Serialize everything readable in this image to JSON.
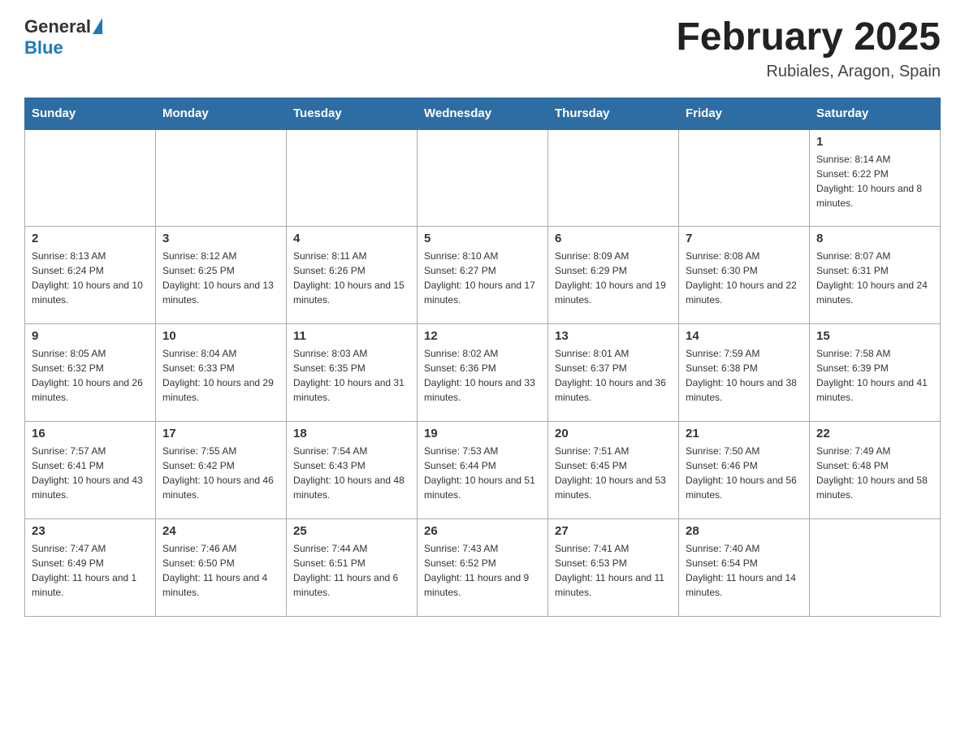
{
  "header": {
    "logo_general": "General",
    "logo_blue": "Blue",
    "month_title": "February 2025",
    "location": "Rubiales, Aragon, Spain"
  },
  "days_of_week": [
    "Sunday",
    "Monday",
    "Tuesday",
    "Wednesday",
    "Thursday",
    "Friday",
    "Saturday"
  ],
  "weeks": [
    [
      {
        "day": "",
        "info": ""
      },
      {
        "day": "",
        "info": ""
      },
      {
        "day": "",
        "info": ""
      },
      {
        "day": "",
        "info": ""
      },
      {
        "day": "",
        "info": ""
      },
      {
        "day": "",
        "info": ""
      },
      {
        "day": "1",
        "info": "Sunrise: 8:14 AM\nSunset: 6:22 PM\nDaylight: 10 hours and 8 minutes."
      }
    ],
    [
      {
        "day": "2",
        "info": "Sunrise: 8:13 AM\nSunset: 6:24 PM\nDaylight: 10 hours and 10 minutes."
      },
      {
        "day": "3",
        "info": "Sunrise: 8:12 AM\nSunset: 6:25 PM\nDaylight: 10 hours and 13 minutes."
      },
      {
        "day": "4",
        "info": "Sunrise: 8:11 AM\nSunset: 6:26 PM\nDaylight: 10 hours and 15 minutes."
      },
      {
        "day": "5",
        "info": "Sunrise: 8:10 AM\nSunset: 6:27 PM\nDaylight: 10 hours and 17 minutes."
      },
      {
        "day": "6",
        "info": "Sunrise: 8:09 AM\nSunset: 6:29 PM\nDaylight: 10 hours and 19 minutes."
      },
      {
        "day": "7",
        "info": "Sunrise: 8:08 AM\nSunset: 6:30 PM\nDaylight: 10 hours and 22 minutes."
      },
      {
        "day": "8",
        "info": "Sunrise: 8:07 AM\nSunset: 6:31 PM\nDaylight: 10 hours and 24 minutes."
      }
    ],
    [
      {
        "day": "9",
        "info": "Sunrise: 8:05 AM\nSunset: 6:32 PM\nDaylight: 10 hours and 26 minutes."
      },
      {
        "day": "10",
        "info": "Sunrise: 8:04 AM\nSunset: 6:33 PM\nDaylight: 10 hours and 29 minutes."
      },
      {
        "day": "11",
        "info": "Sunrise: 8:03 AM\nSunset: 6:35 PM\nDaylight: 10 hours and 31 minutes."
      },
      {
        "day": "12",
        "info": "Sunrise: 8:02 AM\nSunset: 6:36 PM\nDaylight: 10 hours and 33 minutes."
      },
      {
        "day": "13",
        "info": "Sunrise: 8:01 AM\nSunset: 6:37 PM\nDaylight: 10 hours and 36 minutes."
      },
      {
        "day": "14",
        "info": "Sunrise: 7:59 AM\nSunset: 6:38 PM\nDaylight: 10 hours and 38 minutes."
      },
      {
        "day": "15",
        "info": "Sunrise: 7:58 AM\nSunset: 6:39 PM\nDaylight: 10 hours and 41 minutes."
      }
    ],
    [
      {
        "day": "16",
        "info": "Sunrise: 7:57 AM\nSunset: 6:41 PM\nDaylight: 10 hours and 43 minutes."
      },
      {
        "day": "17",
        "info": "Sunrise: 7:55 AM\nSunset: 6:42 PM\nDaylight: 10 hours and 46 minutes."
      },
      {
        "day": "18",
        "info": "Sunrise: 7:54 AM\nSunset: 6:43 PM\nDaylight: 10 hours and 48 minutes."
      },
      {
        "day": "19",
        "info": "Sunrise: 7:53 AM\nSunset: 6:44 PM\nDaylight: 10 hours and 51 minutes."
      },
      {
        "day": "20",
        "info": "Sunrise: 7:51 AM\nSunset: 6:45 PM\nDaylight: 10 hours and 53 minutes."
      },
      {
        "day": "21",
        "info": "Sunrise: 7:50 AM\nSunset: 6:46 PM\nDaylight: 10 hours and 56 minutes."
      },
      {
        "day": "22",
        "info": "Sunrise: 7:49 AM\nSunset: 6:48 PM\nDaylight: 10 hours and 58 minutes."
      }
    ],
    [
      {
        "day": "23",
        "info": "Sunrise: 7:47 AM\nSunset: 6:49 PM\nDaylight: 11 hours and 1 minute."
      },
      {
        "day": "24",
        "info": "Sunrise: 7:46 AM\nSunset: 6:50 PM\nDaylight: 11 hours and 4 minutes."
      },
      {
        "day": "25",
        "info": "Sunrise: 7:44 AM\nSunset: 6:51 PM\nDaylight: 11 hours and 6 minutes."
      },
      {
        "day": "26",
        "info": "Sunrise: 7:43 AM\nSunset: 6:52 PM\nDaylight: 11 hours and 9 minutes."
      },
      {
        "day": "27",
        "info": "Sunrise: 7:41 AM\nSunset: 6:53 PM\nDaylight: 11 hours and 11 minutes."
      },
      {
        "day": "28",
        "info": "Sunrise: 7:40 AM\nSunset: 6:54 PM\nDaylight: 11 hours and 14 minutes."
      },
      {
        "day": "",
        "info": ""
      }
    ]
  ]
}
